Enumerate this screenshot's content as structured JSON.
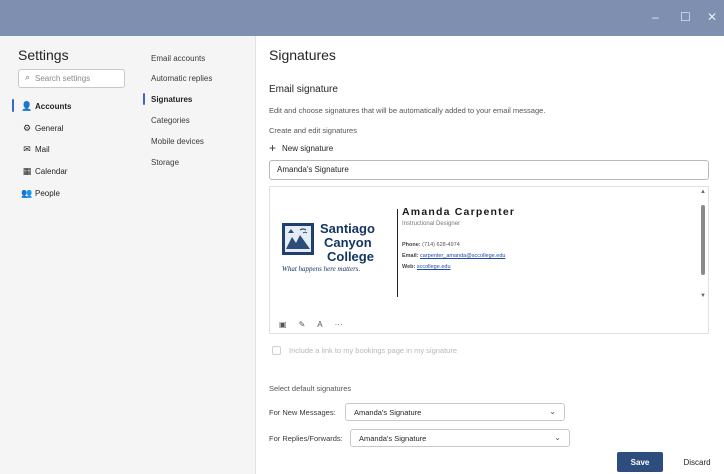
{
  "window": {
    "controls": {
      "minimize": "–",
      "maximize": "☐",
      "close": "✕"
    },
    "titlebar_color": "#7e8fb0"
  },
  "settings": {
    "title": "Settings",
    "search_placeholder": "Search settings",
    "nav": [
      {
        "label": "Accounts",
        "icon": "person-icon",
        "glyph": "👤",
        "selected": true
      },
      {
        "label": "General",
        "icon": "gear-icon",
        "glyph": "⚙"
      },
      {
        "label": "Mail",
        "icon": "mail-icon",
        "glyph": "✉"
      },
      {
        "label": "Calendar",
        "icon": "calendar-icon",
        "glyph": "▦"
      },
      {
        "label": "People",
        "icon": "people-icon",
        "glyph": "👥"
      }
    ]
  },
  "accounts_nav": [
    {
      "label": "Email accounts"
    },
    {
      "label": "Automatic replies"
    },
    {
      "label": "Signatures",
      "selected": true
    },
    {
      "label": "Categories"
    },
    {
      "label": "Mobile devices"
    },
    {
      "label": "Storage"
    }
  ],
  "main": {
    "title": "Signatures",
    "section_title": "Email signature",
    "description": "Edit and choose signatures that will be automatically added to your email message.",
    "create_label": "Create and edit signatures",
    "new_signature": "New signature",
    "signature_name": "Amanda's Signature"
  },
  "signature": {
    "logo_lines": [
      "Santiago",
      "Canyon",
      "College"
    ],
    "tagline": "What happens here matters.",
    "name": "Amanda Carpenter",
    "role": "Instructional Designer",
    "phone_label": "Phone:",
    "phone": "(714) 628-4974",
    "email_label": "Email:",
    "email": "carpenter_amanda@sccollege.edu",
    "web_label": "Web:",
    "web": "sccollege.edu"
  },
  "toolbar": {
    "image": "▣",
    "pen": "✎",
    "format": "A",
    "more": "···"
  },
  "bookings_label": "Include a link to my bookings page in my signature",
  "defaults": {
    "title": "Select default signatures",
    "new_messages_label": "For New Messages:",
    "new_messages_value": "Amanda's Signature",
    "replies_label": "For Replies/Forwards:",
    "replies_value": "Amanda's Signature"
  },
  "actions": {
    "save": "Save",
    "discard": "Discard"
  },
  "colors": {
    "accent": "#3a67c9",
    "save_button": "#2e4d7f",
    "logo_navy": "#143563"
  }
}
